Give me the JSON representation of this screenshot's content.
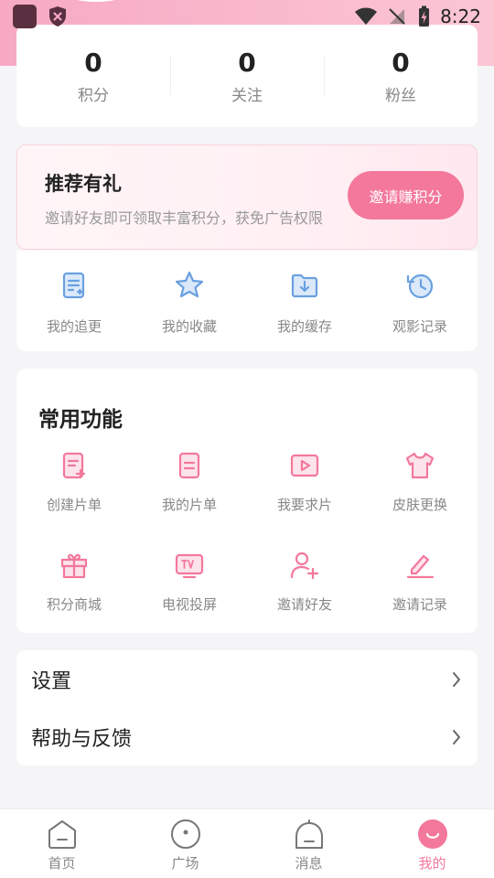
{
  "status": {
    "time": "8:22"
  },
  "stats": [
    {
      "value": "0",
      "label": "积分"
    },
    {
      "value": "0",
      "label": "关注"
    },
    {
      "value": "0",
      "label": "粉丝"
    }
  ],
  "invite": {
    "title": "推荐有礼",
    "description": "邀请好友即可领取丰富积分，获免广告权限",
    "button": "邀请赚积分"
  },
  "quick": [
    {
      "label": "我的追更",
      "icon": "update-list-icon"
    },
    {
      "label": "我的收藏",
      "icon": "star-icon"
    },
    {
      "label": "我的缓存",
      "icon": "download-folder-icon"
    },
    {
      "label": "观影记录",
      "icon": "history-icon"
    }
  ],
  "functions": {
    "title": "常用功能",
    "items": [
      {
        "label": "创建片单",
        "icon": "create-list-icon"
      },
      {
        "label": "我的片单",
        "icon": "list-icon"
      },
      {
        "label": "我要求片",
        "icon": "play-request-icon"
      },
      {
        "label": "皮肤更换",
        "icon": "shirt-icon"
      },
      {
        "label": "积分商城",
        "icon": "gift-icon"
      },
      {
        "label": "电视投屏",
        "icon": "tv-icon"
      },
      {
        "label": "邀请好友",
        "icon": "add-user-icon"
      },
      {
        "label": "邀请记录",
        "icon": "edit-icon"
      }
    ]
  },
  "settings": [
    {
      "label": "设置"
    },
    {
      "label": "帮助与反馈"
    }
  ],
  "nav": [
    {
      "label": "首页",
      "icon": "home-icon"
    },
    {
      "label": "广场",
      "icon": "square-icon"
    },
    {
      "label": "消息",
      "icon": "message-icon"
    },
    {
      "label": "我的",
      "icon": "profile-icon",
      "active": true
    }
  ],
  "colors": {
    "accent": "#f3789b",
    "quick_icon": "#6aa0e0"
  }
}
